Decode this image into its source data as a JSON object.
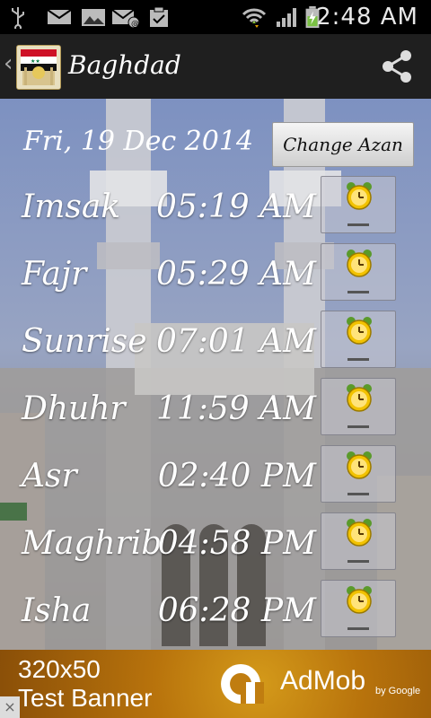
{
  "status_bar": {
    "time": "2:48 AM",
    "icons": [
      "usb-icon",
      "mail-icon",
      "gallery-icon",
      "email-icon",
      "clipboard-icon",
      "wifi-icon",
      "signal-icon",
      "battery-charging-icon"
    ]
  },
  "header": {
    "title": "Baghdad",
    "app_icon": "mosque-flag-icon",
    "share_icon": "share-icon"
  },
  "main": {
    "date": "Fri, 19 Dec 2014",
    "change_azan_label": "Change Azan",
    "prayers": [
      {
        "name": "Imsak",
        "time": "05:19 AM"
      },
      {
        "name": "Fajr",
        "time": "05:29 AM"
      },
      {
        "name": "Sunrise",
        "time": "07:01 AM"
      },
      {
        "name": "Dhuhr",
        "time": "11:59 AM"
      },
      {
        "name": "Asr",
        "time": "02:40 PM"
      },
      {
        "name": "Maghrib",
        "time": "04:58 PM"
      },
      {
        "name": "Isha",
        "time": "06:28 PM"
      }
    ]
  },
  "ad": {
    "line1": "320x50",
    "line2": "Test Banner",
    "brand": "AdMob",
    "by": "by Google",
    "close": "×"
  },
  "colors": {
    "statusbar_bg": "#000000",
    "actionbar_bg": "#1f1f1f",
    "alarm_yellow": "#f2c200",
    "alarm_green": "#5a9a2a",
    "ad_orange": "#c07d10"
  }
}
